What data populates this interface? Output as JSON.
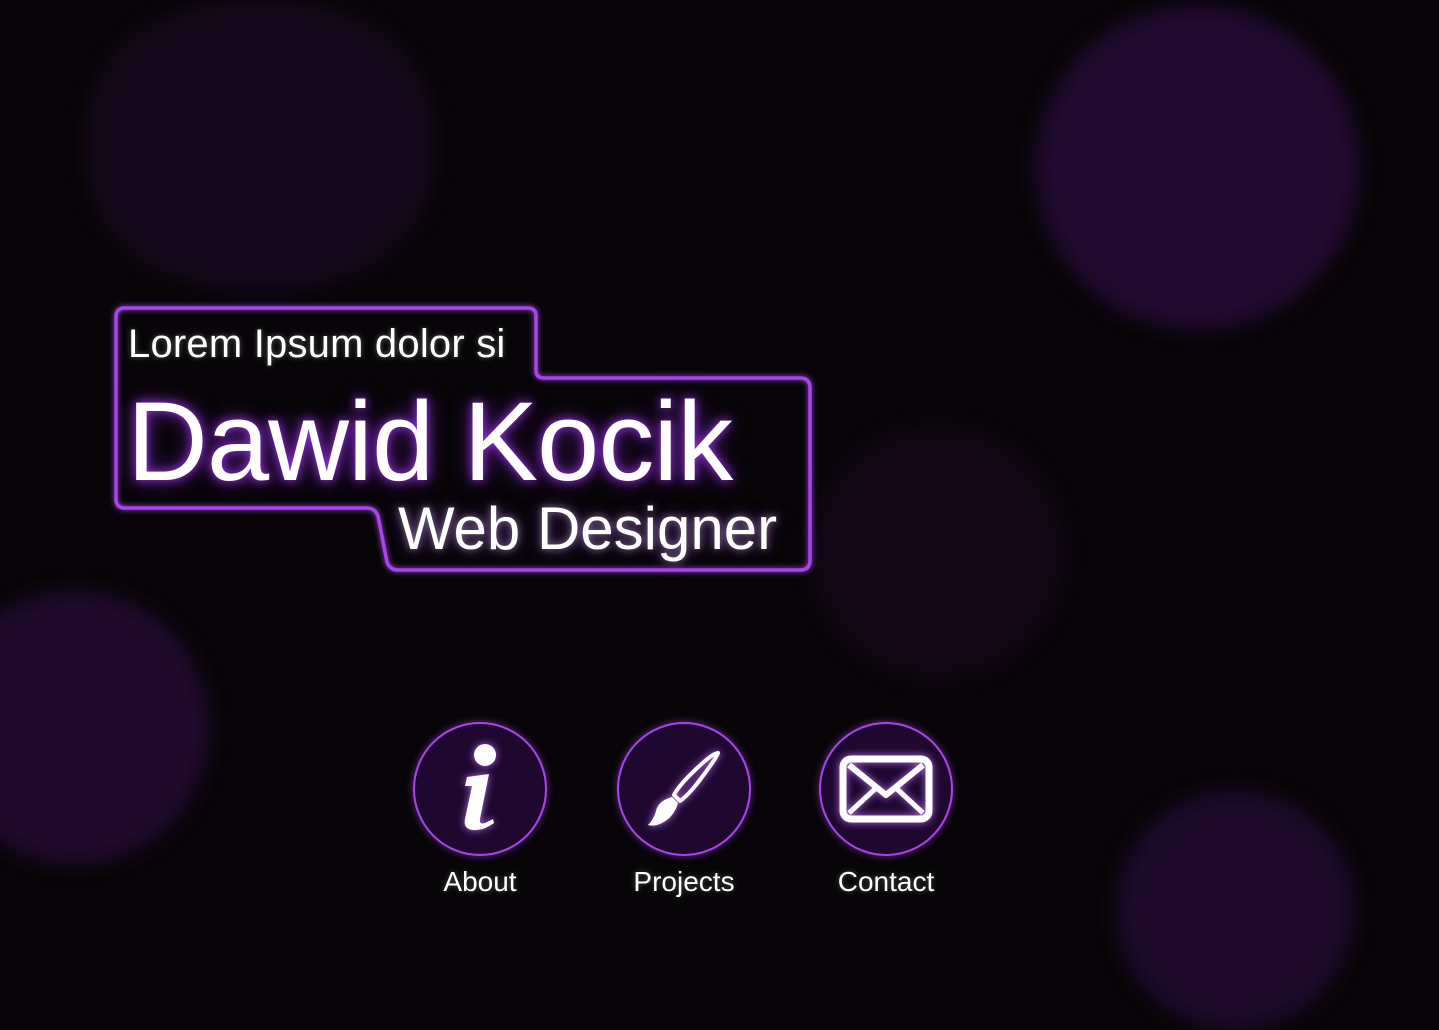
{
  "header": {
    "tagline": "Lorem Ipsum dolor si",
    "name": "Dawid Kocik",
    "role": "Web Designer"
  },
  "nav": {
    "items": [
      {
        "label": "About",
        "icon": "info-icon"
      },
      {
        "label": "Projects",
        "icon": "paintbrush-icon"
      },
      {
        "label": "Contact",
        "icon": "envelope-icon"
      }
    ]
  },
  "colors": {
    "accent": "#a645e8",
    "background": "#070507",
    "circle_fill": "#1e0830",
    "text": "#ffffff"
  }
}
